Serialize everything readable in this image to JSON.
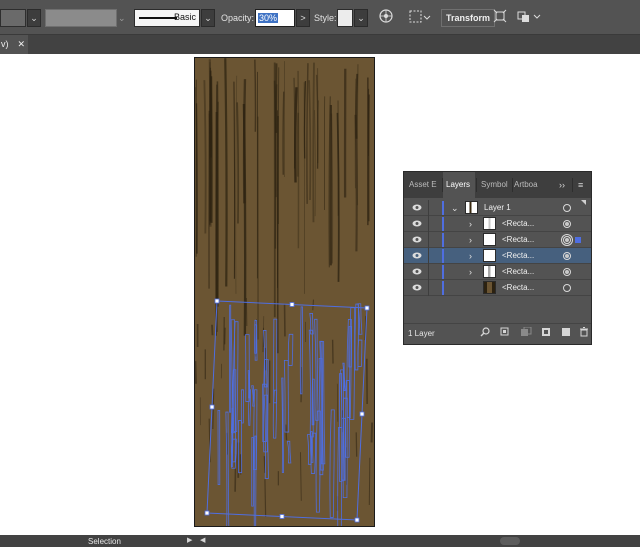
{
  "control_bar": {
    "brush_label": "Basic",
    "opacity_label": "Opacity:",
    "opacity_value": "30%",
    "style_label": "Style:",
    "transform_label": "Transform",
    "gt_glyph": ">",
    "dd_glyph": "⌄"
  },
  "tab": {
    "label": "v)",
    "close": "✕"
  },
  "layers_panel": {
    "tabs": [
      "Asset E",
      "Layers",
      "Symbol",
      "Artboa"
    ],
    "active_tab": "Layers",
    "more": "››",
    "menu": "≡",
    "rows": [
      {
        "name": "Layer 1",
        "kind": "layer",
        "expanded": true,
        "selected": false
      },
      {
        "name": "<Recta...",
        "kind": "sublayer",
        "selected": false
      },
      {
        "name": "<Recta...",
        "kind": "sublayer",
        "selected": false,
        "targeted": true
      },
      {
        "name": "<Recta...",
        "kind": "sublayer",
        "selected": true
      },
      {
        "name": "<Recta...",
        "kind": "sublayer",
        "selected": false
      },
      {
        "name": "<Recta...",
        "kind": "sublayer",
        "selected": false
      }
    ],
    "footer_label": "1 Layer",
    "footer_icons": [
      "search-icon",
      "collect-icon",
      "clipping-mask-icon",
      "new-sublayer-icon",
      "new-layer-icon",
      "trash-icon"
    ]
  },
  "status_bar": {
    "tool": "Selection",
    "prev": "◀",
    "last": "▶"
  },
  "colors": {
    "wood": "#6b5533",
    "grain": "#2c2211",
    "selection": "#4f6ee0",
    "panel": "#535353",
    "selected_row": "#46607e"
  }
}
